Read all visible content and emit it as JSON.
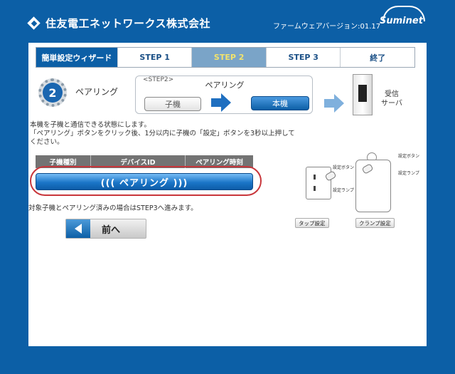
{
  "header": {
    "company": "住友電工ネットワークス株式会社",
    "firmware": "ファームウェアバージョン:01.17",
    "logo": "Suminet"
  },
  "tabs": [
    {
      "label": "簡単設定ウィザード"
    },
    {
      "label": "STEP 1"
    },
    {
      "label": "STEP 2"
    },
    {
      "label": "STEP 3"
    },
    {
      "label": "終了"
    }
  ],
  "step": {
    "number": "2",
    "label": "ペアリング"
  },
  "flow": {
    "step_tag": "<STEP2>",
    "title": "ペアリング",
    "child": "子機",
    "parent": "本機",
    "receiver": "受信\nサーバ"
  },
  "description": "本機を子機と通信できる状態にします。\n「ペアリング」ボタンをクリック後、1分以内に子機の「設定」ボタンを3秒以上押してください。",
  "table": {
    "headers": [
      "子機種別",
      "デバイスID",
      "ペアリング時刻"
    ]
  },
  "pairing_button": "((( ペアリング )))",
  "note": "対象子機とペアリング済みの場合はSTEP3へ進みます。",
  "back_button": "前へ",
  "illustration": {
    "tap_button_label": "設定ボタン",
    "tap_lamp_label": "設定ランプ",
    "clamp_button_label": "設定ボタン",
    "clamp_lamp_label": "設定ランプ",
    "tap_caption": "タップ設定",
    "clamp_caption": "クランプ設定"
  }
}
